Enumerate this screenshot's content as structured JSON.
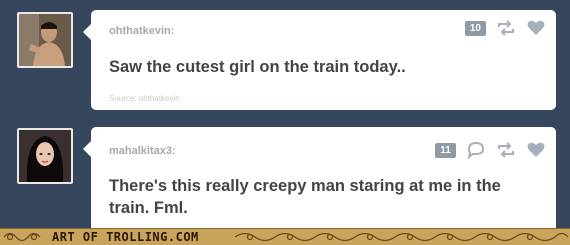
{
  "posts": [
    {
      "username": "ohthatkevin:",
      "text": "Saw the cutest girl on the train today..",
      "source": "Source: ohthatkevin",
      "notes": "10",
      "icons": [
        "reblog-icon",
        "heart-icon"
      ]
    },
    {
      "username": "mahalkitax3:",
      "text": "There's this really creepy man staring at me in the train. Fml.",
      "notes": "11",
      "icons": [
        "reply-icon",
        "reblog-icon",
        "heart-icon"
      ]
    }
  ],
  "footer": {
    "watermark": "ART OF TROLLING.COM"
  },
  "colors": {
    "background": "#36465d",
    "card": "#ffffff",
    "note_badge": "#8e9ba6",
    "icon": "#a6b0ba"
  }
}
